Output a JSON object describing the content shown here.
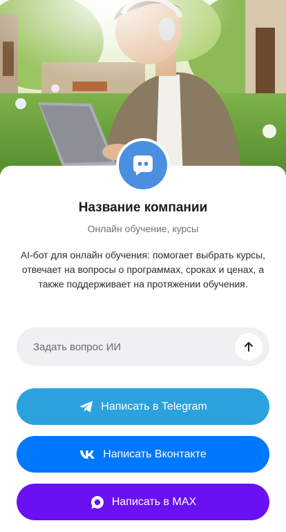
{
  "hero": {
    "image": "hero-photo"
  },
  "brand": {
    "avatar_icon": "chat-bot-icon",
    "name": "Название компании",
    "tagline": "Онлайн обучение, курсы",
    "description": "AI-бот для онлайн обучения: помогает выбрать курсы, отвечает на вопросы о программах, сроках и ценах, а также поддерживает на протяжении обучения."
  },
  "ask": {
    "placeholder": "Задать вопрос ИИ",
    "send_icon": "arrow-up-icon"
  },
  "buttons": {
    "telegram": {
      "label": "Написать в Telegram",
      "icon": "telegram-icon",
      "color": "#2aa2de"
    },
    "vk": {
      "label": "Написать Вконтакте",
      "icon": "vk-icon",
      "color": "#0077ff"
    },
    "max": {
      "label": "Написать в MAX",
      "icon": "max-icon",
      "color": "#6a11f2"
    }
  },
  "colors": {
    "accent": "#4a8fe0",
    "input_bg": "#f0f0f2"
  }
}
